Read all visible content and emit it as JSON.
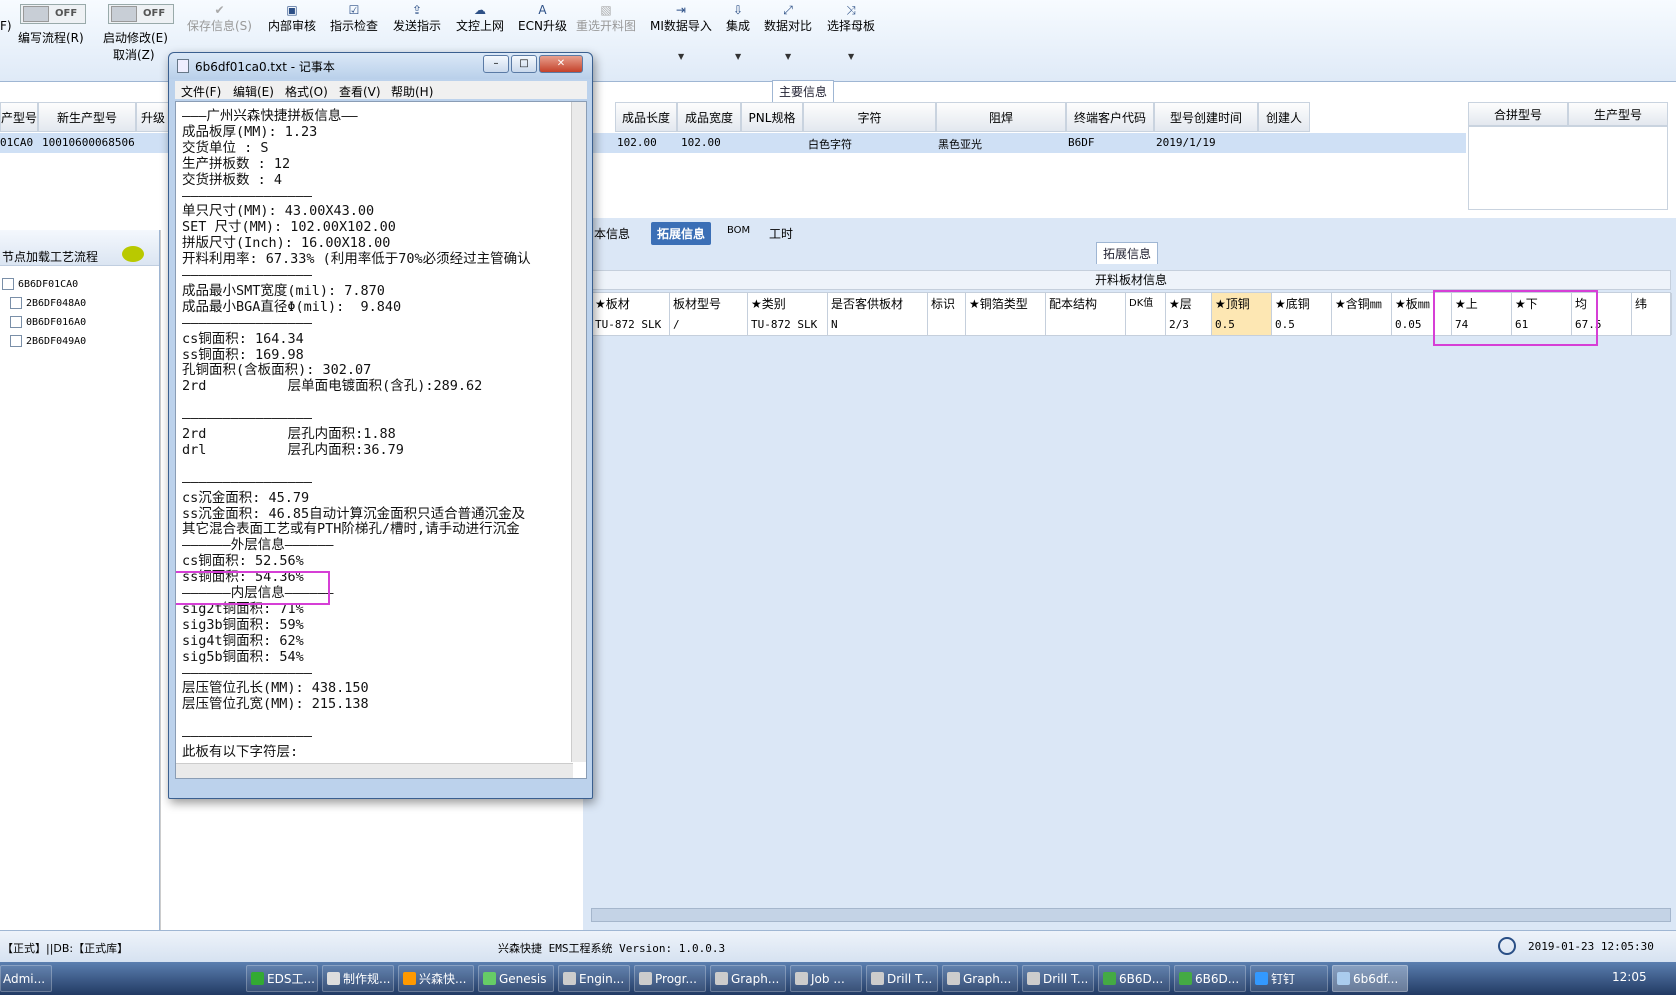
{
  "ribbon": {
    "toggle1": "OFF",
    "toggle2": "OFF",
    "write_flow": "编写流程(R)",
    "start_modify": "启动修改(E)",
    "cancel": "取消(Z)",
    "prefix_f": "F)",
    "buttons": [
      "保存信息(S)",
      "内部审核",
      "指示检查",
      "发送指示",
      "文控上网",
      "ECN升级",
      "重选开料图",
      "MI数据导入",
      "集成",
      "数据对比",
      "选择母板"
    ]
  },
  "main_info": {
    "tab_label": "主要信息",
    "headers": [
      "产型号",
      "新生产型号",
      "升级",
      "成品长度",
      "成品宽度",
      "PNL规格",
      "字符",
      "阻焊",
      "终端客户代码",
      "型号创建时间",
      "创建人",
      "合拼型号",
      "生产型号"
    ],
    "row": {
      "col0": "01CA0",
      "col1": "10010600068506",
      "len": "102.00",
      "wid": "102.00",
      "char": "白色字符",
      "solder": "黑色亚光",
      "cust": "B6DF",
      "date": "2019/1/19"
    }
  },
  "left": {
    "title": "节点加载工艺流程",
    "items": [
      "6B6DF01CA0",
      "2B6DF048A0",
      "0B6DF016A0",
      "2B6DF049A0"
    ]
  },
  "right": {
    "tabs": [
      "本信息",
      "拓展信息",
      "BOM",
      "工时"
    ],
    "sub_tab": "拓展信息",
    "section_title": "开料板材信息",
    "headers": [
      "★板材",
      "板材型号",
      "★类别",
      "是否客供板材",
      "标识",
      "★铜箔类型",
      "配本结构",
      "DK值",
      "★层",
      "★顶铜",
      "★底铜",
      "★含铜㎜",
      "★板㎜",
      "★上",
      "★下",
      "均",
      "纬"
    ],
    "values": [
      "TU-872 SLK",
      "/",
      "TU-872 SLK",
      "N",
      "",
      "",
      "",
      "",
      "2/3",
      "0.5",
      "0.5",
      "",
      "0.05",
      "74",
      "61",
      "67.5",
      ""
    ]
  },
  "notepad": {
    "title": "6b6df01ca0.txt - 记事本",
    "menu": [
      "文件(F)",
      "编辑(E)",
      "格式(O)",
      "查看(V)",
      "帮助(H)"
    ],
    "lines": [
      "———广州兴森快捷拼板信息——",
      "成品板厚(MM): 1.23",
      "交货单位 : S",
      "生产拼板数 : 12",
      "交货拼板数 : 4",
      "————————————————",
      "单只尺寸(MM): 43.00X43.00",
      "SET 尺寸(MM): 102.00X102.00",
      "拼版尺寸(Inch): 16.00X18.00",
      "开料利用率: 67.33% (利用率低于70%必须经过主管确认",
      "————————————————",
      "成品最小SMT宽度(mil): 7.870",
      "成品最小BGA直径Φ(mil):  9.840",
      "————————————————",
      "cs铜面积: 164.34",
      "ss铜面积: 169.98",
      "孔铜面积(含板面积): 302.07",
      "2rd          层单面电镀面积(含孔):289.62",
      "",
      "————————————————",
      "2rd          层孔内面积:1.88",
      "drl          层孔内面积:36.79",
      "",
      "————————————————",
      "cs沉金面积: 45.79",
      "ss沉金面积: 46.85自动计算沉金面积只适合普通沉金及",
      "其它混合表面工艺或有PTH阶梯孔/槽时,请手动进行沉金",
      "——————外层信息——————",
      "cs铜面积: 52.56%",
      "ss铜面积: 54.36%",
      "——————内层信息——————",
      "sig2t铜面积: 71%",
      "sig3b铜面积: 59%",
      "sig4t铜面积: 62%",
      "sig5b铜面积: 54%",
      "————————————————",
      "层压管位孔长(MM): 438.150",
      "层压管位孔宽(MM): 215.138",
      "",
      "————————————————",
      "此板有以下字符层:"
    ]
  },
  "status": {
    "left": "【正式】||DB:【正式库】",
    "center": "兴森快捷 EMS工程系统 Version: 1.0.0.3",
    "datetime": "2019-01-23 12:05:30"
  },
  "taskbar": {
    "items": [
      "Admi...",
      "EDS工...",
      "制作规...",
      "兴森快...",
      "Genesis",
      "Engin...",
      "Progr...",
      "Graph...",
      "Job ...",
      "Drill T...",
      "Graph...",
      "Drill T...",
      "6B6D...",
      "6B6D...",
      "钉钉",
      "6b6df..."
    ],
    "clock": "12:05"
  }
}
